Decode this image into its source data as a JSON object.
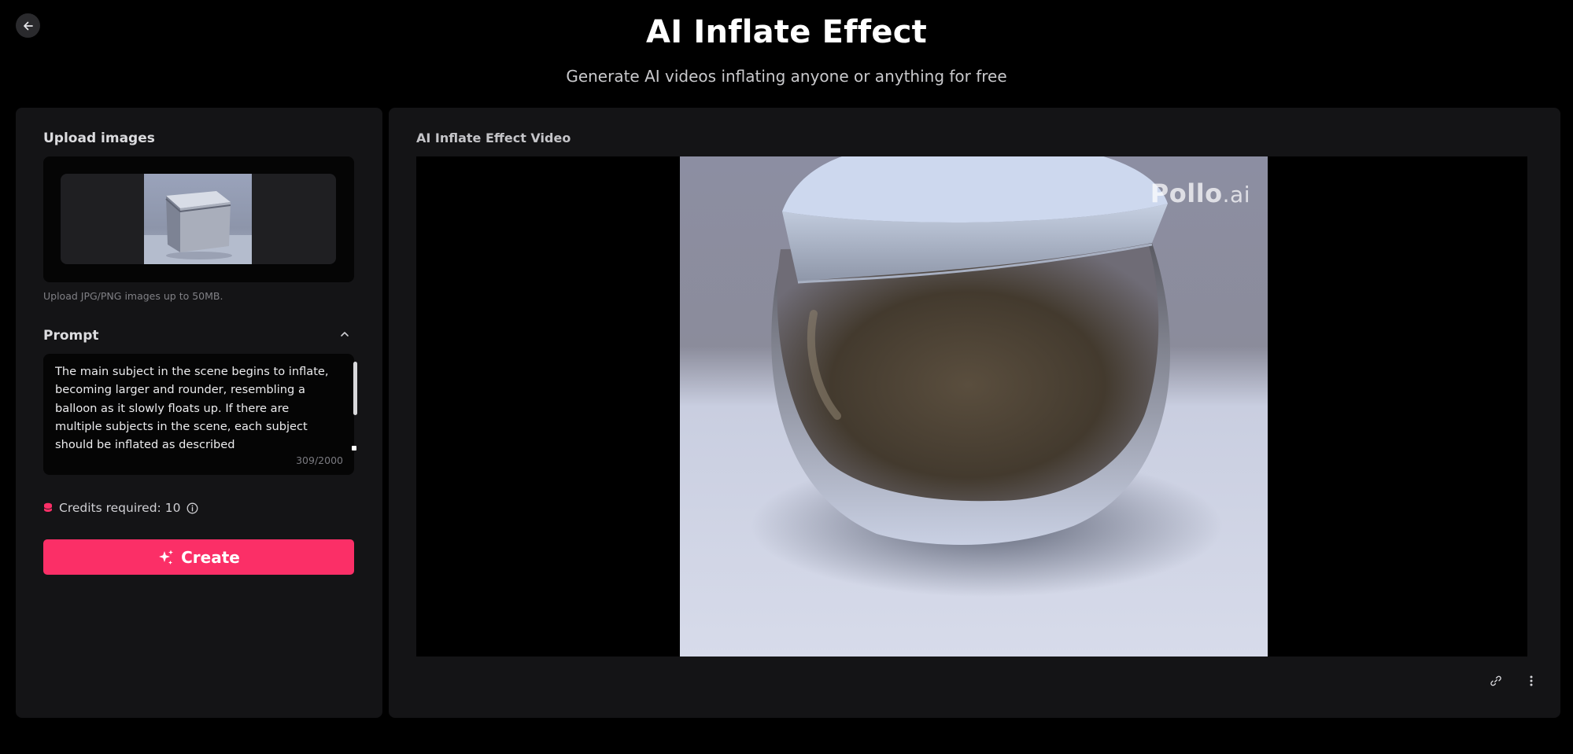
{
  "header": {
    "title": "AI Inflate Effect",
    "subtitle": "Generate AI videos inflating anyone or anything for free"
  },
  "left_panel": {
    "upload_label": "Upload images",
    "upload_hint": "Upload JPG/PNG images up to 50MB.",
    "prompt_label": "Prompt",
    "prompt_text": "The main subject in the scene begins to inflate, becoming larger and rounder, resembling a balloon as it slowly floats up. If there are multiple subjects in the scene, each subject should be inflated as described",
    "char_count": "309/2000",
    "credits_text": "Credits required: 10",
    "create_label": "Create"
  },
  "right_panel": {
    "video_label": "AI Inflate Effect Video",
    "watermark_main": "Pollo",
    "watermark_suffix": ".ai"
  },
  "colors": {
    "accent": "#fb2f67",
    "panel": "#141416",
    "background": "#000000"
  }
}
